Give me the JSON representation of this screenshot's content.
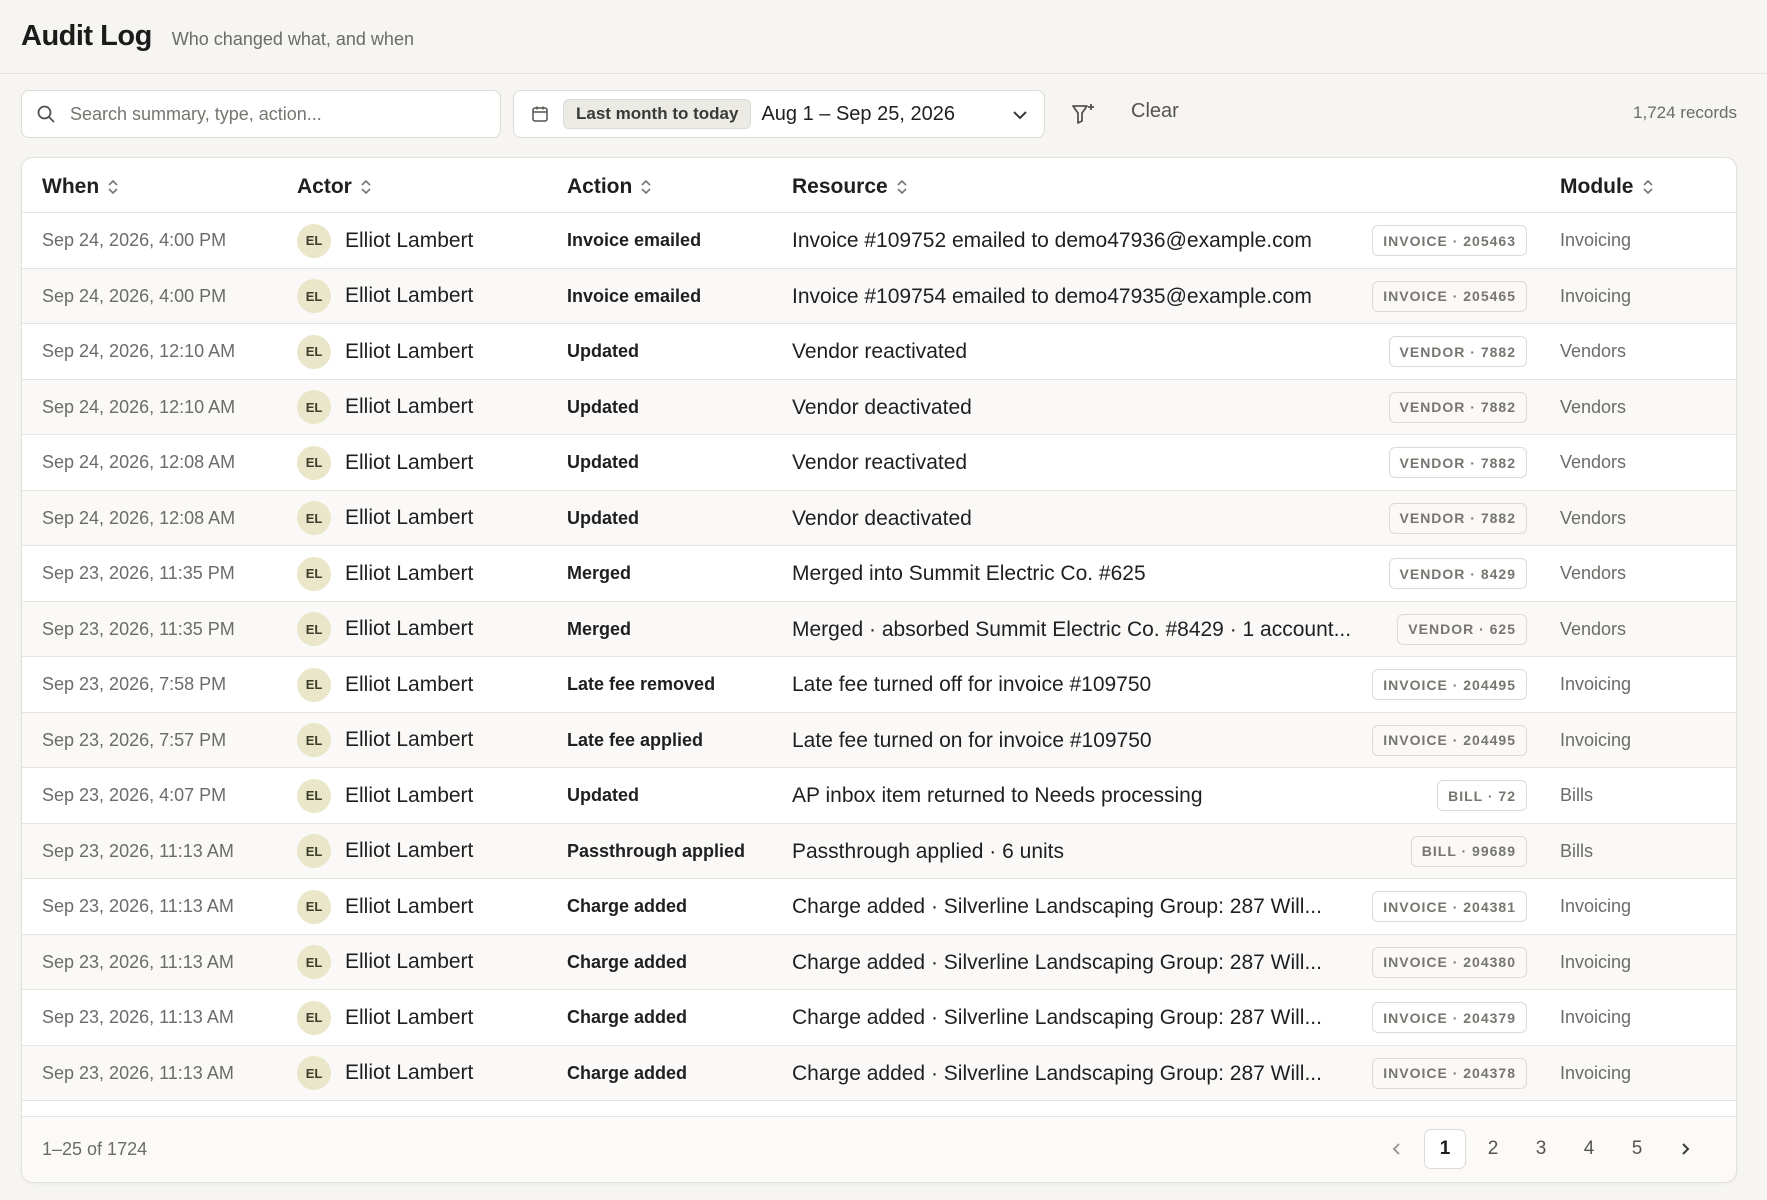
{
  "header": {
    "title": "Audit Log",
    "subtitle": "Who changed what, and when"
  },
  "toolbar": {
    "search_placeholder": "Search summary, type, action...",
    "search_icon": "search-icon",
    "date_icon": "calendar-icon",
    "date_preset": "Last month to today",
    "date_range": "Aug 1 – Sep 25, 2026",
    "filter_icon": "filter-add-icon",
    "clear_label": "Clear",
    "records_count": "1,724 records"
  },
  "table": {
    "columns": {
      "when": "When",
      "actor": "Actor",
      "action": "Action",
      "resource": "Resource",
      "module": "Module"
    },
    "rows": [
      {
        "when": "Sep 24, 2026, 4:00 PM",
        "initials": "EL",
        "actor": "Elliot Lambert",
        "action": "Invoice emailed",
        "summary": "Invoice #109752 emailed to demo47936@example.com",
        "tag": "INVOICE · 205463",
        "module": "Invoicing"
      },
      {
        "when": "Sep 24, 2026, 4:00 PM",
        "initials": "EL",
        "actor": "Elliot Lambert",
        "action": "Invoice emailed",
        "summary": "Invoice #109754 emailed to demo47935@example.com",
        "tag": "INVOICE · 205465",
        "module": "Invoicing"
      },
      {
        "when": "Sep 24, 2026, 12:10 AM",
        "initials": "EL",
        "actor": "Elliot Lambert",
        "action": "Updated",
        "summary": "Vendor reactivated",
        "tag": "VENDOR · 7882",
        "module": "Vendors"
      },
      {
        "when": "Sep 24, 2026, 12:10 AM",
        "initials": "EL",
        "actor": "Elliot Lambert",
        "action": "Updated",
        "summary": "Vendor deactivated",
        "tag": "VENDOR · 7882",
        "module": "Vendors"
      },
      {
        "when": "Sep 24, 2026, 12:08 AM",
        "initials": "EL",
        "actor": "Elliot Lambert",
        "action": "Updated",
        "summary": "Vendor reactivated",
        "tag": "VENDOR · 7882",
        "module": "Vendors"
      },
      {
        "when": "Sep 24, 2026, 12:08 AM",
        "initials": "EL",
        "actor": "Elliot Lambert",
        "action": "Updated",
        "summary": "Vendor deactivated",
        "tag": "VENDOR · 7882",
        "module": "Vendors"
      },
      {
        "when": "Sep 23, 2026, 11:35 PM",
        "initials": "EL",
        "actor": "Elliot Lambert",
        "action": "Merged",
        "summary": "Merged into Summit Electric Co. #625",
        "tag": "VENDOR · 8429",
        "module": "Vendors"
      },
      {
        "when": "Sep 23, 2026, 11:35 PM",
        "initials": "EL",
        "actor": "Elliot Lambert",
        "action": "Merged",
        "summary": "Merged · absorbed Summit Electric Co. #8429 · 1 account...",
        "tag": "VENDOR · 625",
        "module": "Vendors"
      },
      {
        "when": "Sep 23, 2026, 7:58 PM",
        "initials": "EL",
        "actor": "Elliot Lambert",
        "action": "Late fee removed",
        "summary": "Late fee turned off for invoice #109750",
        "tag": "INVOICE · 204495",
        "module": "Invoicing"
      },
      {
        "when": "Sep 23, 2026, 7:57 PM",
        "initials": "EL",
        "actor": "Elliot Lambert",
        "action": "Late fee applied",
        "summary": "Late fee turned on for invoice #109750",
        "tag": "INVOICE · 204495",
        "module": "Invoicing"
      },
      {
        "when": "Sep 23, 2026, 4:07 PM",
        "initials": "EL",
        "actor": "Elliot Lambert",
        "action": "Updated",
        "summary": "AP inbox item returned to Needs processing",
        "tag": "BILL · 72",
        "module": "Bills"
      },
      {
        "when": "Sep 23, 2026, 11:13 AM",
        "initials": "EL",
        "actor": "Elliot Lambert",
        "action": "Passthrough applied",
        "summary": "Passthrough applied · 6 units",
        "tag": "BILL · 99689",
        "module": "Bills"
      },
      {
        "when": "Sep 23, 2026, 11:13 AM",
        "initials": "EL",
        "actor": "Elliot Lambert",
        "action": "Charge added",
        "summary": "Charge added · Silverline Landscaping Group: 287 Will...",
        "tag": "INVOICE · 204381",
        "module": "Invoicing"
      },
      {
        "when": "Sep 23, 2026, 11:13 AM",
        "initials": "EL",
        "actor": "Elliot Lambert",
        "action": "Charge added",
        "summary": "Charge added · Silverline Landscaping Group: 287 Will...",
        "tag": "INVOICE · 204380",
        "module": "Invoicing"
      },
      {
        "when": "Sep 23, 2026, 11:13 AM",
        "initials": "EL",
        "actor": "Elliot Lambert",
        "action": "Charge added",
        "summary": "Charge added · Silverline Landscaping Group: 287 Will...",
        "tag": "INVOICE · 204379",
        "module": "Invoicing"
      },
      {
        "when": "Sep 23, 2026, 11:13 AM",
        "initials": "EL",
        "actor": "Elliot Lambert",
        "action": "Charge added",
        "summary": "Charge added · Silverline Landscaping Group: 287 Will...",
        "tag": "INVOICE · 204378",
        "module": "Invoicing"
      }
    ]
  },
  "footer": {
    "range_label": "1–25 of 1724",
    "pages": [
      "1",
      "2",
      "3",
      "4",
      "5"
    ],
    "active_page": "1"
  },
  "colors": {
    "background": "#f6f5f2",
    "avatar_bg": "#e9e6c9",
    "border": "#e6e4df"
  }
}
